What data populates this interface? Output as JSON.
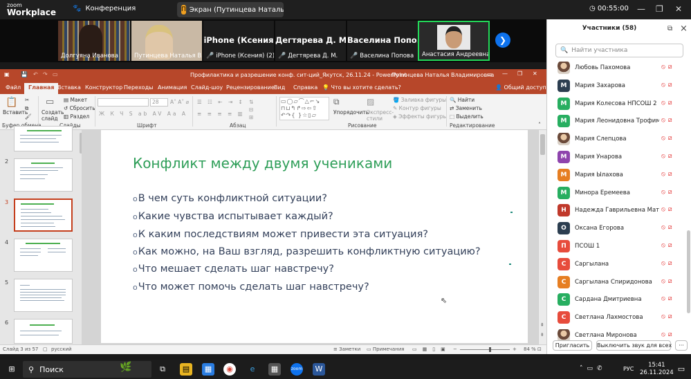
{
  "zoom": {
    "logo_line1": "zoom",
    "logo_line2": "Workplace",
    "conference": "Конференция",
    "share_label": "Экран (Путинцева Наталья Вла",
    "share_icon": "П",
    "timer": "00:55:00"
  },
  "videos": [
    {
      "name": "Долгуяна Иванова"
    },
    {
      "name": "Путинцева Наталья Влад..."
    },
    {
      "big": "iPhone  (Ксения",
      "name": "iPhone (Ксения) (2)"
    },
    {
      "big": "Дегтярева Д. М.",
      "name": "Дегтярева Д. М."
    },
    {
      "big": "Васелина  Попо...",
      "name": "Васелина Попова"
    },
    {
      "name": "Анастасия Андреевна"
    }
  ],
  "ppt": {
    "title": "Профилактика и разрешение конф. сит-ций_Якутск, 26.11.24  -  PowerPoint",
    "user": "Путинцева Наталья Владимировна",
    "tabs": [
      "Файл",
      "Главная",
      "Вставка",
      "Конструктор",
      "Переходы",
      "Анимация",
      "Слайд-шоу",
      "Рецензирование",
      "Вид",
      "Справка",
      "Что вы хотите сделать?"
    ],
    "share": "Общий доступ",
    "ribbon": {
      "paste": "Вставить",
      "create_slide": "Создать слайд",
      "maket": "Макет",
      "reset": "Сбросить",
      "section": "Раздел",
      "font_size": "28",
      "arrange": "Упорядочить",
      "express": "Экспресс-стили",
      "fill": "Заливка фигуры",
      "outline": "Контур фигуры",
      "effects": "Эффекты фигуры",
      "find": "Найти",
      "replace": "Заменить",
      "select": "Выделить",
      "groups": [
        "Буфер обмена",
        "Слайды",
        "Шрифт",
        "Абзац",
        "Рисование",
        "Редактирование"
      ]
    },
    "thumb_numbers": [
      "2",
      "3",
      "4",
      "5",
      "6"
    ],
    "slide": {
      "title": "Конфликт между двумя учениками",
      "bullets": [
        "В чем суть конфликтной ситуации?",
        "Какие чувства испытывает каждый?",
        "К каким последствиям может привести эта ситуация?",
        "Как можно, на Ваш взгляд,  разрешить конфликтную ситуацию?",
        "Что мешает сделать шаг навстречу?",
        "Что может помочь сделать шаг навстречу?"
      ]
    },
    "status": {
      "slide_of": "Слайд 3 из 57",
      "lang": "русский",
      "notes": "Заметки",
      "comments": "Примечания",
      "zoom": "84 %"
    }
  },
  "panel": {
    "title": "Участники (58)",
    "search_placeholder": "Найти участника",
    "participants": [
      {
        "name": "Любовь Пахомова",
        "initial": "",
        "color": "photo"
      },
      {
        "name": "Мария Захарова",
        "initial": "М",
        "color": "#2c3e50"
      },
      {
        "name": "Мария Колесова НПСОШ 2",
        "initial": "М",
        "color": "#27ae60"
      },
      {
        "name": "Мария Леонидовна Трофимова",
        "initial": "М",
        "color": "#27ae60"
      },
      {
        "name": "Мария Слепцова",
        "initial": "",
        "color": "photo"
      },
      {
        "name": "Мария Унарова",
        "initial": "М",
        "color": "#8e44ad"
      },
      {
        "name": "Мария Ылахова",
        "initial": "М",
        "color": "#e67e22"
      },
      {
        "name": "Минора Еремеева",
        "initial": "М",
        "color": "#27ae60"
      },
      {
        "name": "Надежда Гаврильевна Матчито...",
        "initial": "Н",
        "color": "#c0392b"
      },
      {
        "name": "Оксана Егорова",
        "initial": "О",
        "color": "#2c3e50"
      },
      {
        "name": "ПСОШ 1",
        "initial": "П",
        "color": "#e74c3c"
      },
      {
        "name": "Саргылана",
        "initial": "С",
        "color": "#e74c3c"
      },
      {
        "name": "Саргылана Спиридонова",
        "initial": "С",
        "color": "#e67e22"
      },
      {
        "name": "Сардана Дмитриевна",
        "initial": "С",
        "color": "#27ae60"
      },
      {
        "name": "Светлана Лахмостова",
        "initial": "С",
        "color": "#e74c3c"
      },
      {
        "name": "Светлана Миронова",
        "initial": "",
        "color": "photo"
      }
    ],
    "invite": "Пригласить",
    "unmute_all": "Выключить звук для всех"
  },
  "taskbar": {
    "search": "Поиск",
    "lang": "РУС",
    "time": "15:41",
    "date": "26.11.2024"
  }
}
